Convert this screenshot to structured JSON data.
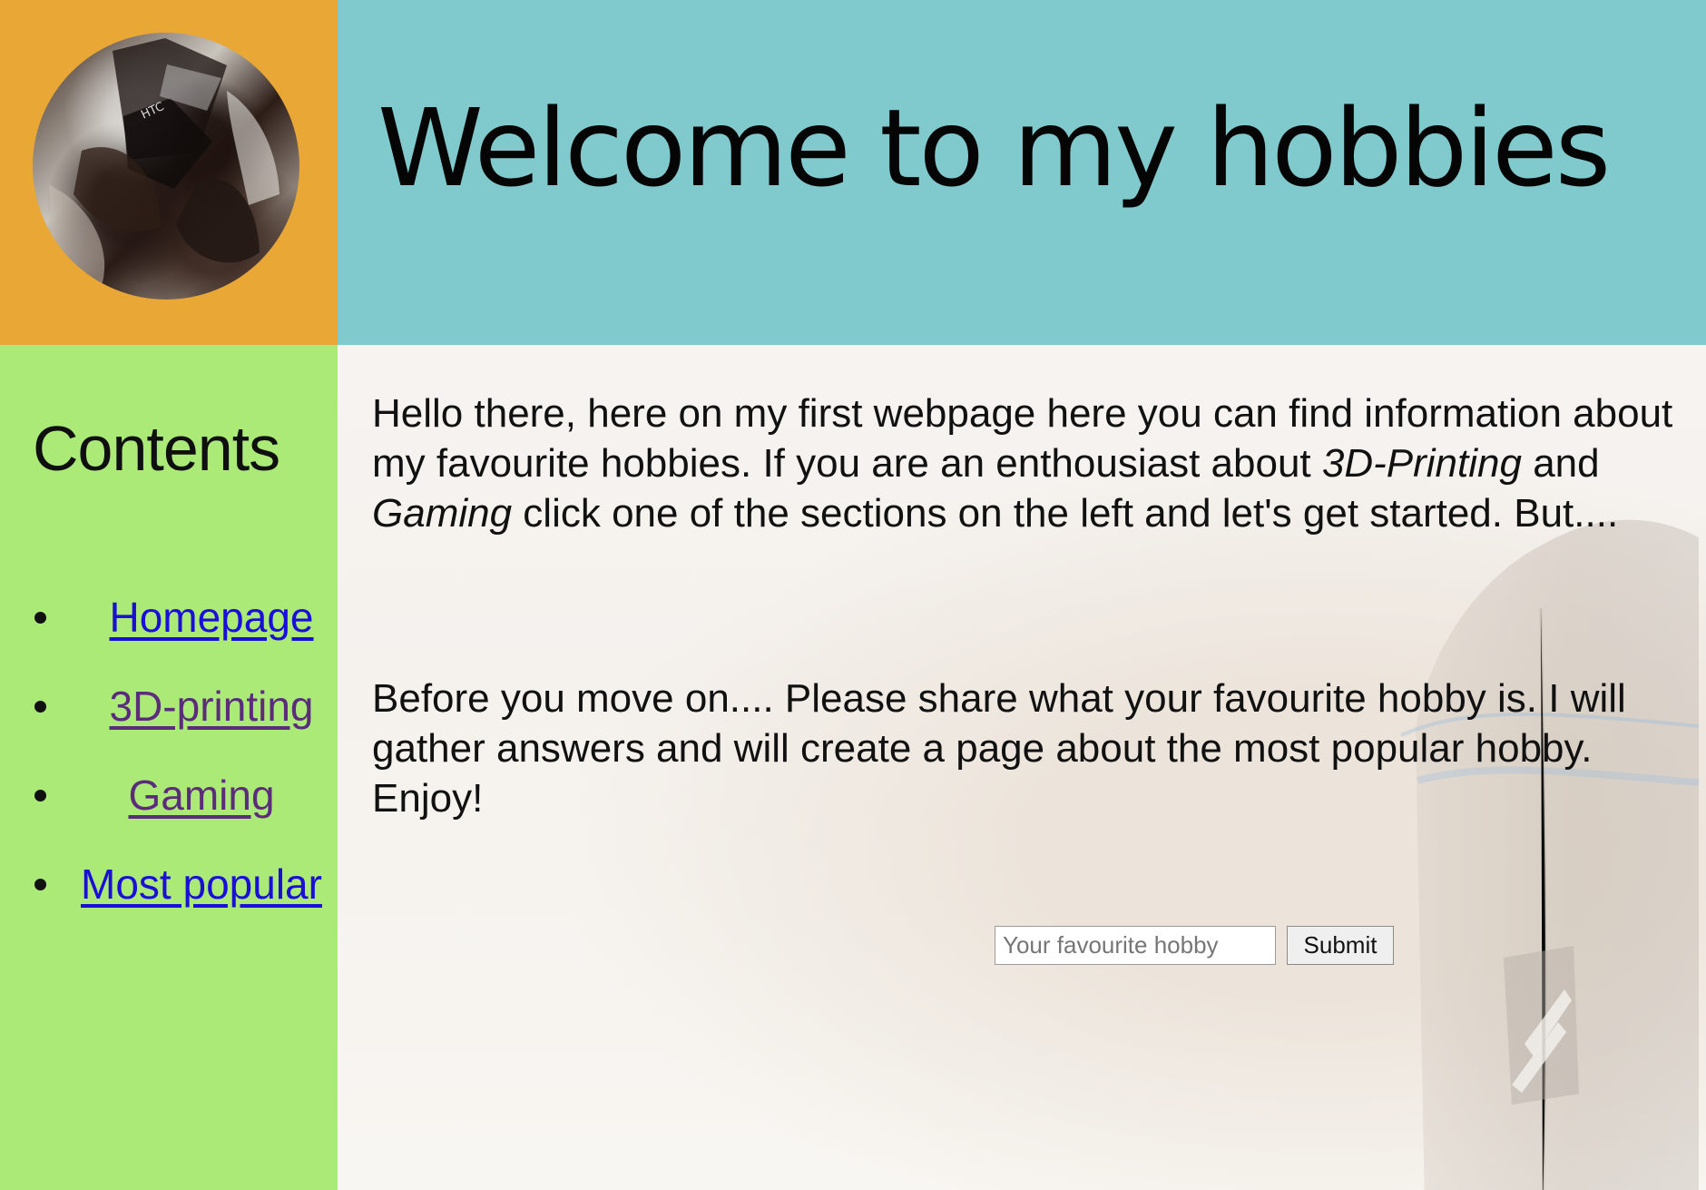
{
  "page": {
    "title": "Welcome to my hobbies"
  },
  "sidebar": {
    "heading": "Contents",
    "items": [
      {
        "label": "Homepage",
        "state": "unvisited"
      },
      {
        "label": "3D-printing",
        "state": "visited"
      },
      {
        "label": "Gaming",
        "state": "visited"
      },
      {
        "label": "Most popular",
        "state": "unvisited"
      }
    ]
  },
  "main": {
    "intro": {
      "part1": "Hello there, here on my first webpage here you can find information about my favourite hobbies. If you are an enthousiast about ",
      "italic1": "3D-Printing",
      "part2": " and ",
      "italic2": "Gaming",
      "part3": " click one of the sections on the left and let's get started. But...."
    },
    "request": "Before you move on.... Please share what your favourite hobby is. I will gather answers and will create a page about the most popular hobby. Enjoy!"
  },
  "form": {
    "placeholder": "Your favourite hobby",
    "value": "",
    "submit_label": "Submit"
  },
  "colors": {
    "avatar_bg": "#e9a736",
    "header_bg": "#80c9cc",
    "sidebar_bg": "#acea78",
    "link_unvisited": "#1a0fd6",
    "link_visited": "#5c2c7c"
  },
  "icons": {
    "avatar": "profile-photo",
    "bullet": "disc"
  }
}
